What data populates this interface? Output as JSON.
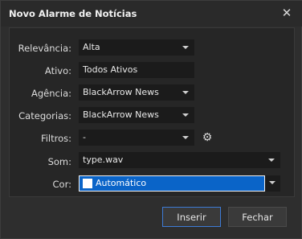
{
  "dialog": {
    "title": "Novo Alarme de Notícias",
    "close_icon": "close-icon"
  },
  "form": {
    "relevancia_label": "Relevância:",
    "relevancia_value": "Alta",
    "ativo_label": "Ativo:",
    "ativo_value": "Todos Ativos",
    "agencia_label": "Agência:",
    "agencia_value": "BlackArrow News",
    "categorias_label": "Categorias:",
    "categorias_value": "BlackArrow News",
    "filtros_label": "Filtros:",
    "filtros_value": "-",
    "som_label": "Som:",
    "som_value": "type.wav",
    "cor_label": "Cor:",
    "cor_value": "Automático",
    "cor_color": "#0a64c8"
  },
  "buttons": {
    "insert_label": "Inserir",
    "close_label": "Fechar"
  }
}
